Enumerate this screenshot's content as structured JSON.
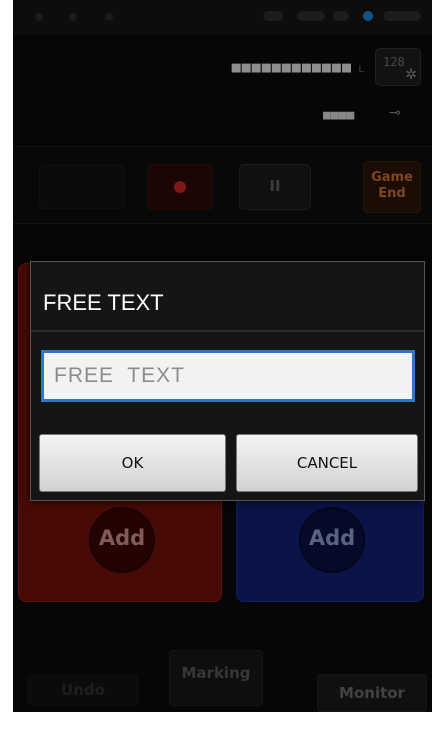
{
  "header": {
    "ticker": "■■■■■■■■■■■■",
    "ticker_sub": "L",
    "settings_number": "128",
    "battery": "■■■■",
    "plug_glyph": "⊸"
  },
  "controls": {
    "pause_label": "II",
    "game_end_line1": "Game",
    "game_end_line2": "End"
  },
  "teams": {
    "home_add_label": "Add",
    "away_add_label": "Add"
  },
  "bottom_bar": {
    "undo_label": "Undo",
    "marking_label": "Marking",
    "monitor_label": "Monitor"
  },
  "dialog": {
    "title": "FREE TEXT",
    "input_placeholder": "FREE  TEXT",
    "input_value": "",
    "ok_label": "OK",
    "cancel_label": "CANCEL"
  },
  "colors": {
    "accent_blue": "#2b78c6",
    "record_red": "#c22424",
    "game_end_orange": "#c56a2a",
    "home_team": "#6e100a",
    "away_team": "#10206e"
  }
}
